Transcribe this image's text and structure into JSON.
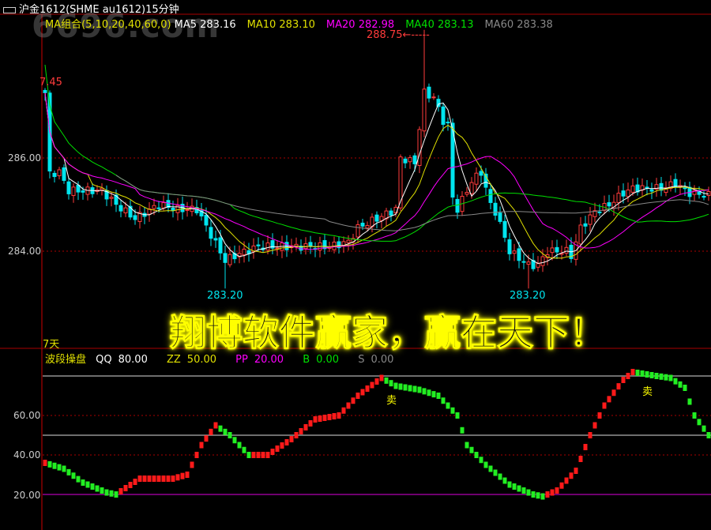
{
  "title": "沪金1612(SHME  au1612)15分钟",
  "watermark": "6696.com",
  "ma_header": {
    "label": "MA组合(5,10,20,40,60,0)",
    "ma5": "MA5 283.16",
    "ma10": "MA10 283.10",
    "ma20": "MA20 282.98",
    "ma40": "MA40 283.13",
    "ma60": "MA60 283.38"
  },
  "annotations": {
    "high": "288.75←-----",
    "left_high": "7.45",
    "low1": "283.20",
    "low2": "283.20",
    "period": "7天"
  },
  "banner": "翔博软件赢家，赢在天下！",
  "sub_header": {
    "name": "波段操盘",
    "qq_l": "QQ",
    "qq_v": "80.00",
    "zz_l": "ZZ",
    "zz_v": "50.00",
    "pp_l": "PP",
    "pp_v": "20.00",
    "b_l": "B",
    "b_v": "0.00",
    "s_l": "S",
    "s_v": "0.00"
  },
  "colors": {
    "up": "#ff3b3b",
    "down": "#00e5ee",
    "ma5": "#ffffff",
    "ma10": "#e0e000",
    "ma20": "#ff00ff",
    "ma40": "#00e000",
    "ma60": "#888888",
    "osc_up": "#ff1a1a",
    "osc_down": "#22ee22"
  },
  "chart_data": [
    {
      "type": "candlestick",
      "title": "沪金1612 15分钟",
      "y_ticks": [
        "286.00",
        "284.00"
      ],
      "ylim": [
        282.9,
        288.9
      ],
      "price_path": [
        [
          0,
          287.4
        ],
        [
          1,
          285.66
        ],
        [
          3,
          285.7
        ],
        [
          5,
          285.3
        ],
        [
          8,
          285.3
        ],
        [
          12,
          285.3
        ],
        [
          15,
          285.0
        ],
        [
          19,
          284.7
        ],
        [
          24,
          285.0
        ],
        [
          28,
          284.9
        ],
        [
          32,
          284.9
        ],
        [
          38,
          283.8
        ],
        [
          41,
          283.95
        ],
        [
          45,
          284.1
        ],
        [
          52,
          284.1
        ],
        [
          60,
          284.1
        ],
        [
          64,
          284.2
        ],
        [
          66,
          284.5
        ],
        [
          70,
          284.7
        ],
        [
          74,
          284.9
        ],
        [
          75,
          286.0
        ],
        [
          78,
          285.9
        ],
        [
          80,
          287.4
        ],
        [
          82,
          287.3
        ],
        [
          84,
          286.8
        ],
        [
          85,
          286.7
        ],
        [
          86,
          285.15
        ],
        [
          87,
          284.9
        ],
        [
          90,
          285.5
        ],
        [
          92,
          285.7
        ],
        [
          94,
          285.0
        ],
        [
          95,
          284.85
        ],
        [
          97,
          284.3
        ],
        [
          98,
          284.0
        ],
        [
          102,
          283.7
        ],
        [
          104,
          283.7
        ],
        [
          106,
          284.0
        ],
        [
          110,
          284.0
        ],
        [
          111,
          283.9
        ],
        [
          113,
          284.5
        ],
        [
          116,
          284.85
        ],
        [
          119,
          285.0
        ],
        [
          122,
          285.25
        ],
        [
          124,
          285.35
        ],
        [
          130,
          285.35
        ],
        [
          133,
          285.45
        ],
        [
          136,
          285.25
        ],
        [
          140,
          285.2
        ]
      ],
      "extremes": {
        "high": 288.75,
        "low": 283.2
      }
    },
    {
      "type": "bar",
      "title": "波段操盘",
      "y_ticks": [
        "60.00",
        "40.00",
        "20.00"
      ],
      "ylim": [
        10,
        85
      ],
      "ref_lines": [
        80,
        50,
        20
      ],
      "osc_path": [
        [
          0,
          36
        ],
        [
          4,
          33
        ],
        [
          8,
          26
        ],
        [
          13,
          21
        ],
        [
          15,
          20
        ],
        [
          20,
          28
        ],
        [
          27,
          28
        ],
        [
          30,
          30
        ],
        [
          33,
          45
        ],
        [
          36,
          55
        ],
        [
          39,
          50
        ],
        [
          43,
          40
        ],
        [
          47,
          40
        ],
        [
          52,
          48
        ],
        [
          57,
          58
        ],
        [
          62,
          60
        ],
        [
          66,
          70
        ],
        [
          71,
          79
        ],
        [
          74,
          75
        ],
        [
          79,
          73
        ],
        [
          83,
          70
        ],
        [
          87,
          60
        ],
        [
          89,
          45
        ],
        [
          93,
          35
        ],
        [
          98,
          25
        ],
        [
          103,
          20
        ],
        [
          105,
          19
        ],
        [
          108,
          22
        ],
        [
          112,
          32
        ],
        [
          115,
          50
        ],
        [
          118,
          65
        ],
        [
          122,
          78
        ],
        [
          124,
          82
        ],
        [
          129,
          80
        ],
        [
          132,
          79
        ],
        [
          135,
          74
        ],
        [
          137,
          60
        ],
        [
          140,
          50
        ]
      ],
      "signals": [
        {
          "index": 73,
          "label": "卖"
        },
        {
          "index": 127,
          "label": "卖"
        }
      ]
    }
  ]
}
